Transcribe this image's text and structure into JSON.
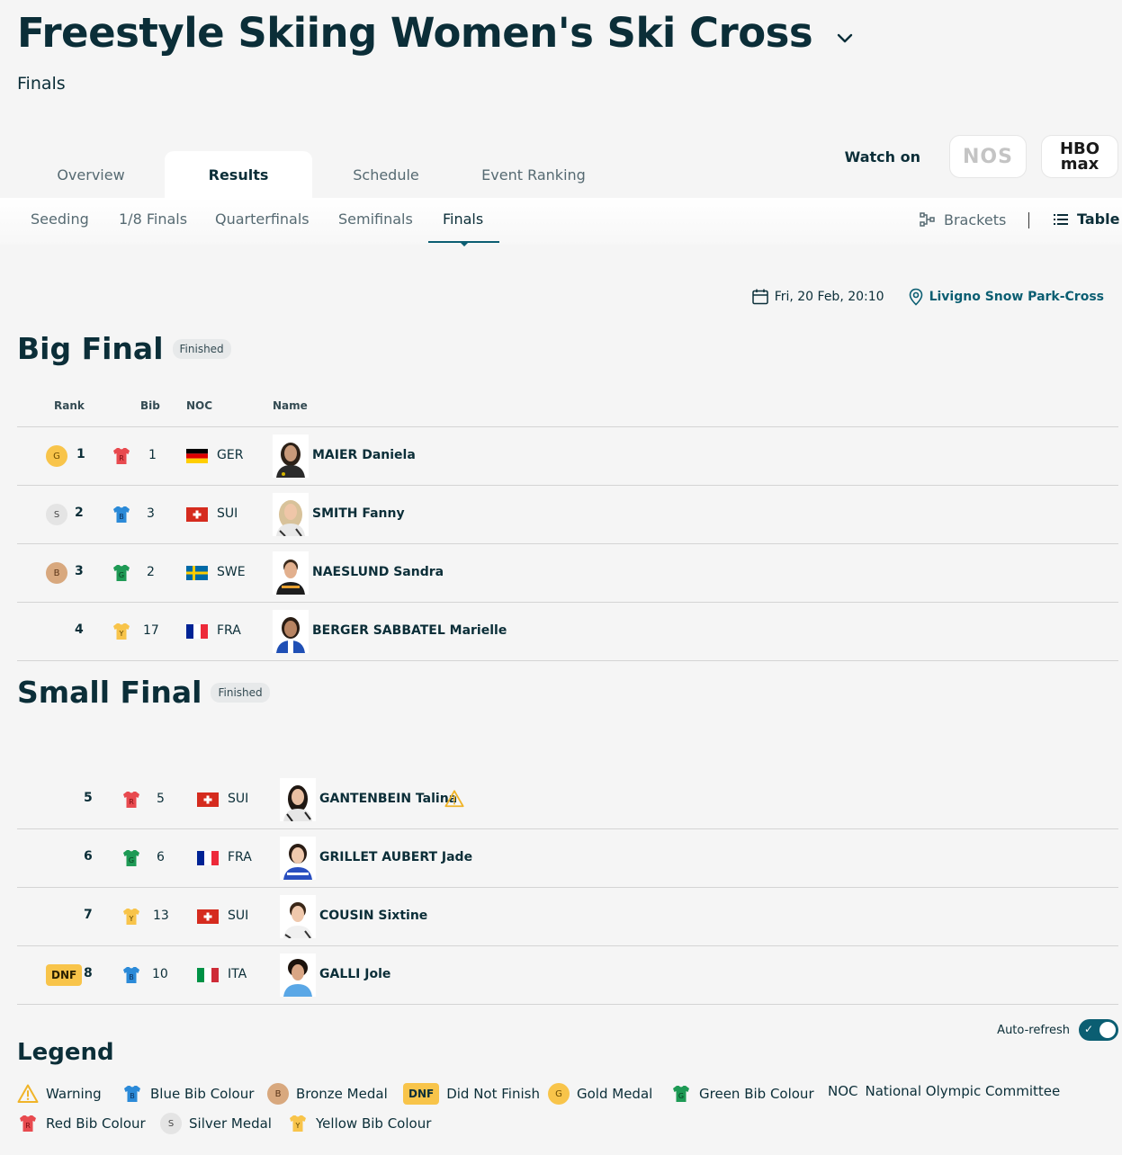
{
  "header": {
    "title": "Freestyle Skiing Women's Ski Cross",
    "subtitle": "Finals"
  },
  "tabs": [
    {
      "label": "Overview",
      "active": false
    },
    {
      "label": "Results",
      "active": true
    },
    {
      "label": "Schedule",
      "active": false
    },
    {
      "label": "Event Ranking",
      "active": false
    }
  ],
  "watch": {
    "label": "Watch on",
    "broadcasters": [
      "NOS",
      "HBO max"
    ]
  },
  "subnav": {
    "items": [
      {
        "label": "Seeding",
        "active": false
      },
      {
        "label": "1/8 Finals",
        "active": false
      },
      {
        "label": "Quarterfinals",
        "active": false
      },
      {
        "label": "Semifinals",
        "active": false
      },
      {
        "label": "Finals",
        "active": true
      }
    ],
    "brackets_label": "Brackets",
    "table_label": "Table"
  },
  "event": {
    "date": "Fri, 20 Feb, 20:10",
    "venue": "Livigno Snow Park-Cross"
  },
  "columns": {
    "rank": "Rank",
    "bib": "Bib",
    "noc": "NOC",
    "name": "Name"
  },
  "big_final": {
    "title": "Big Final",
    "status": "Finished",
    "rows": [
      {
        "medal": "G",
        "rank": "1",
        "bib_colour": "R",
        "bib": "1",
        "noc": "GER",
        "name": "MAIER Daniela"
      },
      {
        "medal": "S",
        "rank": "2",
        "bib_colour": "B",
        "bib": "3",
        "noc": "SUI",
        "name": "SMITH Fanny"
      },
      {
        "medal": "B",
        "rank": "3",
        "bib_colour": "G",
        "bib": "2",
        "noc": "SWE",
        "name": "NAESLUND Sandra"
      },
      {
        "medal": "",
        "rank": "4",
        "bib_colour": "Y",
        "bib": "17",
        "noc": "FRA",
        "name": "BERGER SABBATEL Marielle"
      }
    ]
  },
  "small_final": {
    "title": "Small Final",
    "status": "Finished",
    "rows": [
      {
        "irm": "",
        "rank": "5",
        "bib_colour": "R",
        "bib": "5",
        "noc": "SUI",
        "name": "GANTENBEIN Talina",
        "warning": true
      },
      {
        "irm": "",
        "rank": "6",
        "bib_colour": "G",
        "bib": "6",
        "noc": "FRA",
        "name": "GRILLET AUBERT Jade"
      },
      {
        "irm": "",
        "rank": "7",
        "bib_colour": "Y",
        "bib": "13",
        "noc": "SUI",
        "name": "COUSIN Sixtine"
      },
      {
        "irm": "DNF",
        "rank": "8",
        "bib_colour": "B",
        "bib": "10",
        "noc": "ITA",
        "name": "GALLI Jole"
      }
    ]
  },
  "auto_refresh": {
    "label": "Auto-refresh",
    "on": true
  },
  "legend": {
    "title": "Legend",
    "items": [
      {
        "icon": "warning-icon",
        "label": "Warning"
      },
      {
        "icon": "B",
        "label": "Blue Bib Colour"
      },
      {
        "icon": "B",
        "label": "Bronze Medal"
      },
      {
        "icon": "DNF",
        "label": "Did Not Finish"
      },
      {
        "icon": "G",
        "label": "Gold Medal"
      },
      {
        "icon": "G",
        "label": "Green Bib Colour"
      },
      {
        "icon": "NOC",
        "label": "National Olympic Committee"
      },
      {
        "icon": "R",
        "label": "Red Bib Colour"
      },
      {
        "icon": "S",
        "label": "Silver Medal"
      },
      {
        "icon": "Y",
        "label": "Yellow Bib Colour"
      }
    ]
  },
  "colors": {
    "primary": "#0b2e38",
    "accent": "#0b5e72",
    "bib_red": "#e84a4f",
    "bib_blue": "#2b8ad8",
    "bib_green": "#1e9a55",
    "bib_yellow": "#f8c44a",
    "gold": "#f8c44a",
    "silver": "#e4e4e4",
    "bronze": "#d8a87e"
  }
}
